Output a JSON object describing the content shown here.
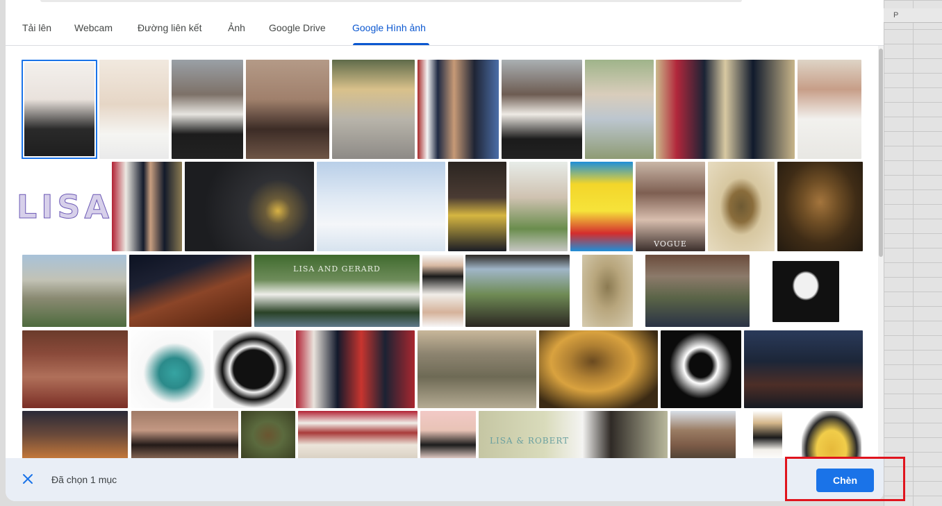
{
  "sheet": {
    "column_label": "P"
  },
  "tabs": [
    {
      "label": "Tải lên"
    },
    {
      "label": "Webcam"
    },
    {
      "label": "Đường liên kết"
    },
    {
      "label": "Ảnh"
    },
    {
      "label": "Google Drive"
    },
    {
      "label": "Google Hình ảnh",
      "active": true
    }
  ],
  "footer": {
    "selected_text": "Đã chọn 1 mục",
    "insert_label": "Chèn"
  },
  "image_texts": {
    "lisa_word": "LISA",
    "vogue": "VOGUE",
    "lisa_gerard": "LISA AND GERARD",
    "lisa_robert": "LISA & ROBERT"
  },
  "colors": {
    "accent": "#1a73e8",
    "highlight": "#e0141d",
    "footer_bg": "#e9eef6"
  }
}
